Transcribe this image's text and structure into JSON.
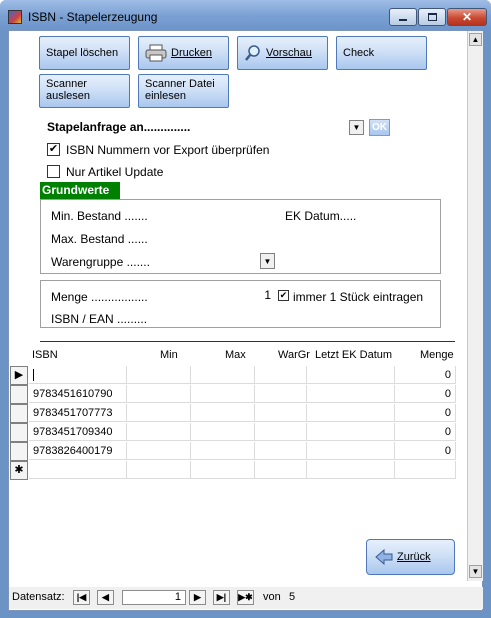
{
  "window": {
    "title": "ISBN - Stapelerzeugung"
  },
  "buttons": {
    "stapel_loeschen": "Stapel löschen",
    "drucken": "Drucken",
    "vorschau": "Vorschau",
    "check": "Check",
    "scanner_auslesen_1": "Scanner",
    "scanner_auslesen_2": "auslesen",
    "scanner_datei_1": "Scanner Datei",
    "scanner_datei_2": "einlesen",
    "zurueck": "Zurück",
    "ok": "OK"
  },
  "stapelanfrage": {
    "label": "Stapelanfrage an..............",
    "value": ""
  },
  "checkboxes": {
    "isbn_check": {
      "label": "ISBN Nummern vor Export überprüfen",
      "checked": true
    },
    "nur_artikel": {
      "label": "Nur Artikel Update",
      "checked": false
    },
    "immer_1": {
      "label": "immer 1 Stück eintragen",
      "checked": true
    }
  },
  "grundwerte": {
    "title": "Grundwerte",
    "min_label": "Min. Bestand .......",
    "min_value": "",
    "ek_label": "EK Datum.....",
    "ek_value": "",
    "max_label": "Max. Bestand ......",
    "max_value": "",
    "warengruppe_label": "Warengruppe .......",
    "warengruppe_value": ""
  },
  "menge": {
    "label": "Menge .................",
    "value": "1",
    "isbn_label": "ISBN / EAN .........",
    "isbn_value": ""
  },
  "table": {
    "headers": [
      "ISBN",
      "Min",
      "Max",
      "WarGr",
      "Letzt EK Datum",
      "Menge"
    ],
    "rows": [
      {
        "isbn": "",
        "menge": "0",
        "current": true
      },
      {
        "isbn": "9783451610790",
        "menge": "0"
      },
      {
        "isbn": "9783451707773",
        "menge": "0"
      },
      {
        "isbn": "9783451709340",
        "menge": "0"
      },
      {
        "isbn": "9783826400179",
        "menge": "0"
      }
    ]
  },
  "navigation": {
    "label": "Datensatz:",
    "current": "1",
    "of_label": "von",
    "total": "5"
  },
  "colors": {
    "accent": "#008000",
    "button": "#cfe0f6",
    "titlebar": "#7aa0d3"
  },
  "icons": [
    "app-icon",
    "printer-icon",
    "magnifier-icon",
    "back-arrow-icon",
    "dropdown-arrow-icon"
  ]
}
